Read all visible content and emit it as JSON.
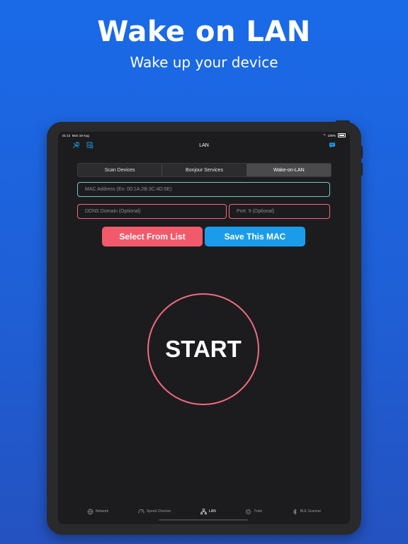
{
  "hero": {
    "title": "Wake on LAN",
    "subtitle": "Wake up your device"
  },
  "status_bar": {
    "time": "01:12",
    "date": "Mon 19 Aug",
    "battery": "100%"
  },
  "nav": {
    "title": "LAN"
  },
  "segments": [
    {
      "label": "Scan Devices",
      "active": false
    },
    {
      "label": "Bonjour Services",
      "active": false
    },
    {
      "label": "Wake-on-LAN",
      "active": true
    }
  ],
  "form": {
    "mac_placeholder": "MAC Address (Ex: 00:1A:2B:3C:4D:5E)",
    "ddns_placeholder": "DDNS Domain (Optional)",
    "port_placeholder": "Port: 9 (Optional)"
  },
  "buttons": {
    "select_from_list": "Select From List",
    "save_mac": "Save This MAC"
  },
  "start": {
    "label": "START"
  },
  "tabbar": [
    {
      "label": "Network",
      "icon": "globe-icon",
      "active": false
    },
    {
      "label": "Speed Checker",
      "icon": "speedometer-icon",
      "active": false
    },
    {
      "label": "LAN",
      "icon": "lan-icon",
      "active": true
    },
    {
      "label": "Tools",
      "icon": "tools-icon",
      "active": false
    },
    {
      "label": "BLE Scanner",
      "icon": "bluetooth-icon",
      "active": false
    }
  ],
  "colors": {
    "background_top": "#1a6ae8",
    "mac_border": "#6dc9c9",
    "optional_border": "#ef6c7a",
    "select_button": "#f25a6b",
    "save_button": "#1b9cea",
    "start_ring": "#f26b80",
    "accent_icon": "#1b9cea"
  }
}
